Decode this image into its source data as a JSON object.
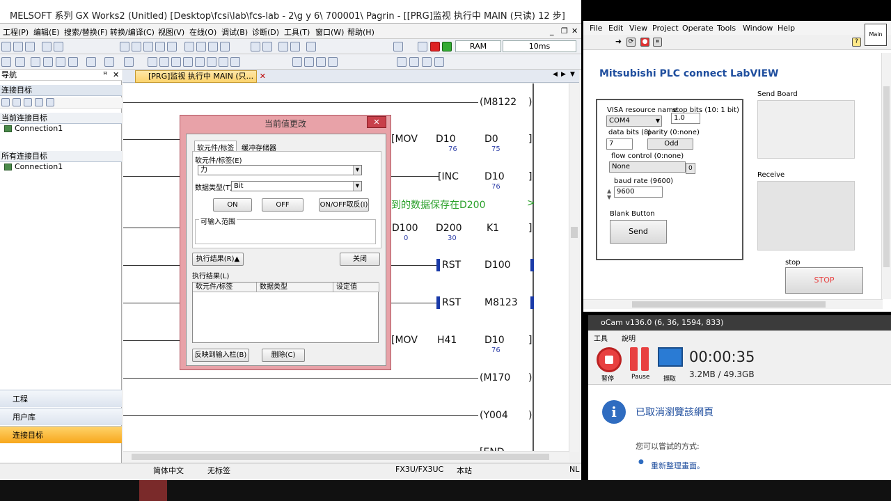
{
  "gx": {
    "title": "MELSOFT 系列 GX Works2 (Unitled) [Desktop\\fcsi\\lab\\fcs-lab - 2\\g y 6\\ 700001\\ Pagrin - [[PRG]监视 执行中 MAIN (只读) 12 步]",
    "menu": [
      "工程(P)",
      "编辑(E)",
      "搜索/替换(F)",
      "转换/编译(C)",
      "视图(V)",
      "在线(O)",
      "调试(B)",
      "诊断(D)",
      "工具(T)",
      "窗口(W)",
      "帮助(H)"
    ],
    "toolbar": {
      "ram": "RAM",
      "scan": "10ms"
    },
    "nav": {
      "title": "导航",
      "section": "连接目标",
      "current_label": "当前连接目标",
      "current_item": "Connection1",
      "all_label": "所有连接目标",
      "all_item": "Connection1",
      "bottom": [
        "工程",
        "用户库",
        "连接目标"
      ]
    },
    "tab": "[PRG]监视 执行中 MAIN (只...",
    "ladder": {
      "coil_m8122": "M8122",
      "mov1": {
        "op": "MOV",
        "a": "D10",
        "av": "76",
        "b": "D0",
        "bv": "75"
      },
      "inc": {
        "op": "INC",
        "a": "D10",
        "av": "76"
      },
      "comment": "到的数据保存在D200",
      "bmov": {
        "a": "D100",
        "av": "0",
        "b": "D200",
        "bv": "30",
        "c": "K1"
      },
      "rst1": {
        "op": "RST",
        "a": "D100"
      },
      "rst2": {
        "op": "RST",
        "a": "M8123"
      },
      "mov2": {
        "op": "MOV",
        "a": "H41",
        "b": "D10",
        "bv": "76"
      },
      "coil_m170": "M170",
      "coil_y004": "Y004",
      "end": "END"
    },
    "status": {
      "lang": "简体中文",
      "label": "无标签",
      "cpu": "FX3U/FX3UC",
      "station": "本站",
      "mode": "NL"
    }
  },
  "dialog": {
    "title": "当前值更改",
    "close": "✕",
    "tabs": [
      "软元件/标签",
      "缓冲存储器"
    ],
    "device_label": "软元件/标签(E)",
    "device_value": "力",
    "type_label": "数据类型(T)",
    "type_value": "Bit",
    "btn_on": "ON",
    "btn_off": "OFF",
    "btn_toggle": "ON/OFF取反(I)",
    "range_label": "可输入范围",
    "exec_btn": "执行结果(R)▲",
    "close_btn": "关闭",
    "result_label": "执行结果(L)",
    "cols": [
      "软元件/标签",
      "数据类型",
      "设定值"
    ],
    "reflect_btn": "反映到输入栏(B)",
    "delete_btn": "删除(C)"
  },
  "labview": {
    "menu": [
      "File",
      "Edit",
      "View",
      "Project",
      "Operate",
      "Tools",
      "Window",
      "Help"
    ],
    "main_icon": "Main",
    "title": "Mitsubishi PLC connect LabVIEW",
    "visa_label": "VISA resource name",
    "visa_value": "COM4",
    "stopbits_label": "stop bits (10: 1 bit)",
    "stopbits_value": "1.0",
    "databits_label": "data bits (8)",
    "databits_value": "7",
    "parity_label": "parity (0:none)",
    "parity_value": "Odd",
    "flow_label": "flow control (0:none)",
    "flow_value": "None",
    "flow_index": "0",
    "baud_label": "baud rate (9600)",
    "baud_value": "9600",
    "blank_label": "Blank Button",
    "send_btn": "Send",
    "send_board": "Send Board",
    "receive": "Receive",
    "stop_label": "stop",
    "stop_btn": "STOP"
  },
  "ocam": {
    "title": "oCam v136.0 (6, 36, 1594, 833)",
    "menu": [
      "工具",
      "說明"
    ],
    "stop_label": "暫停",
    "pause_label": "Pause",
    "capture_label": "擷取",
    "time": "00:00:35",
    "size": "3.2MB / 49.3GB",
    "info_title": "已取消瀏覽該網頁",
    "info_hint": "您可以嘗試的方式:",
    "info_item": "重新整理畫面。"
  },
  "colors": {
    "accent_blue": "#1f4e9e",
    "stop_red": "#e84040",
    "ladder_value": "#3344aa",
    "comment_green": "#2aa02a"
  }
}
